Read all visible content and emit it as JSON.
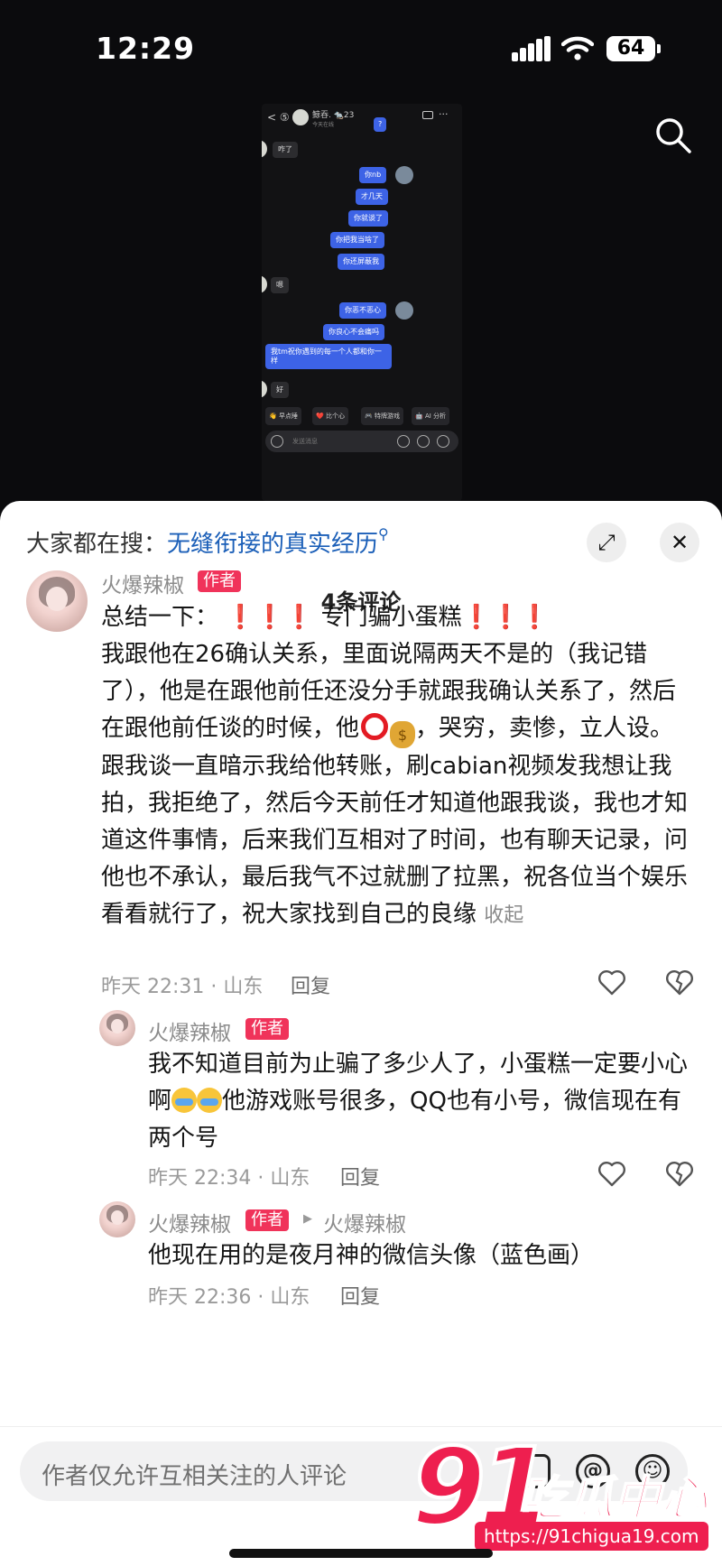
{
  "status_bar": {
    "time": "12:29",
    "battery": "64"
  },
  "chat_image": {
    "contact_name": "鲸吞. 🐀23",
    "contact_status": "今天在线",
    "messages": [
      {
        "side": "out",
        "text": "?"
      },
      {
        "side": "in",
        "text": "咋了"
      },
      {
        "side": "out",
        "text": "你nb"
      },
      {
        "side": "out",
        "text": "才几天"
      },
      {
        "side": "out",
        "text": "你就谈了"
      },
      {
        "side": "out",
        "text": "你把我当啥了"
      },
      {
        "side": "out",
        "text": "你还屏蔽我"
      },
      {
        "side": "in",
        "text": "嗯"
      },
      {
        "side": "out",
        "text": "你恶不恶心"
      },
      {
        "side": "out",
        "text": "你良心不会痛吗"
      },
      {
        "side": "out",
        "text": "我tm祝你遇到的每一个人都和你一样"
      },
      {
        "side": "in",
        "text": "好"
      }
    ],
    "quick_actions": [
      "👋 早点睡",
      "❤️ 比个心",
      "🎮 特牌游戏",
      "🤖 AI 分析"
    ],
    "input_placeholder": "发送消息"
  },
  "sheet": {
    "trending_prefix": "大家都在搜：",
    "trending_keyword": "无缝衔接的真实经历",
    "comment_count": "4条评论"
  },
  "comments": [
    {
      "name": "火爆辣椒",
      "tag": "作者",
      "line1_prefix": "总结一下：",
      "line1_marks": "❗❗❗",
      "line1_mid": "专门骗小蛋糕",
      "line1_marks2": "❗❗❗",
      "body_a": "我跟他在26确认关系，里面说隔两天不是的（我记错了），他是在跟他前任还没分手就跟我确认关系了，然后在跟他前任谈的时候，他",
      "body_b": "，哭穷，卖惨，立人设。跟我谈一直暗示我给他转账，刷cabian视频发我想让我拍，我拒绝了，然后今天前任才知道他跟我谈，我也才知道这件事情，后来我们互相对了时间，也有聊天记录，问他也不承认，最后我气不过就删了拉黑，祝各位当个娱乐看看就行了，祝大家找到自己的良缘",
      "collapse": "收起",
      "meta": "昨天 22:31 · 山东",
      "reply": "回复"
    },
    {
      "name": "火爆辣椒",
      "tag": "作者",
      "body_a": "我不知道目前为止骗了多少人了，小蛋糕一定要小心啊",
      "body_b": "他游戏账号很多，QQ也有小号，微信现在有两个号",
      "meta": "昨天 22:34 · 山东",
      "reply": "回复"
    },
    {
      "name": "火爆辣椒",
      "tag": "作者",
      "reply_to": "火爆辣椒",
      "body": "他现在用的是夜月神的微信头像（蓝色画）",
      "meta": "昨天 22:36 · 山东",
      "reply": "回复"
    }
  ],
  "bottom": {
    "input_placeholder": "作者仅允许互相关注的人评论",
    "at_icon": "@"
  },
  "watermark": {
    "number": "91",
    "brand": "吃瓜中心",
    "url": "https://91chigua19.com"
  }
}
